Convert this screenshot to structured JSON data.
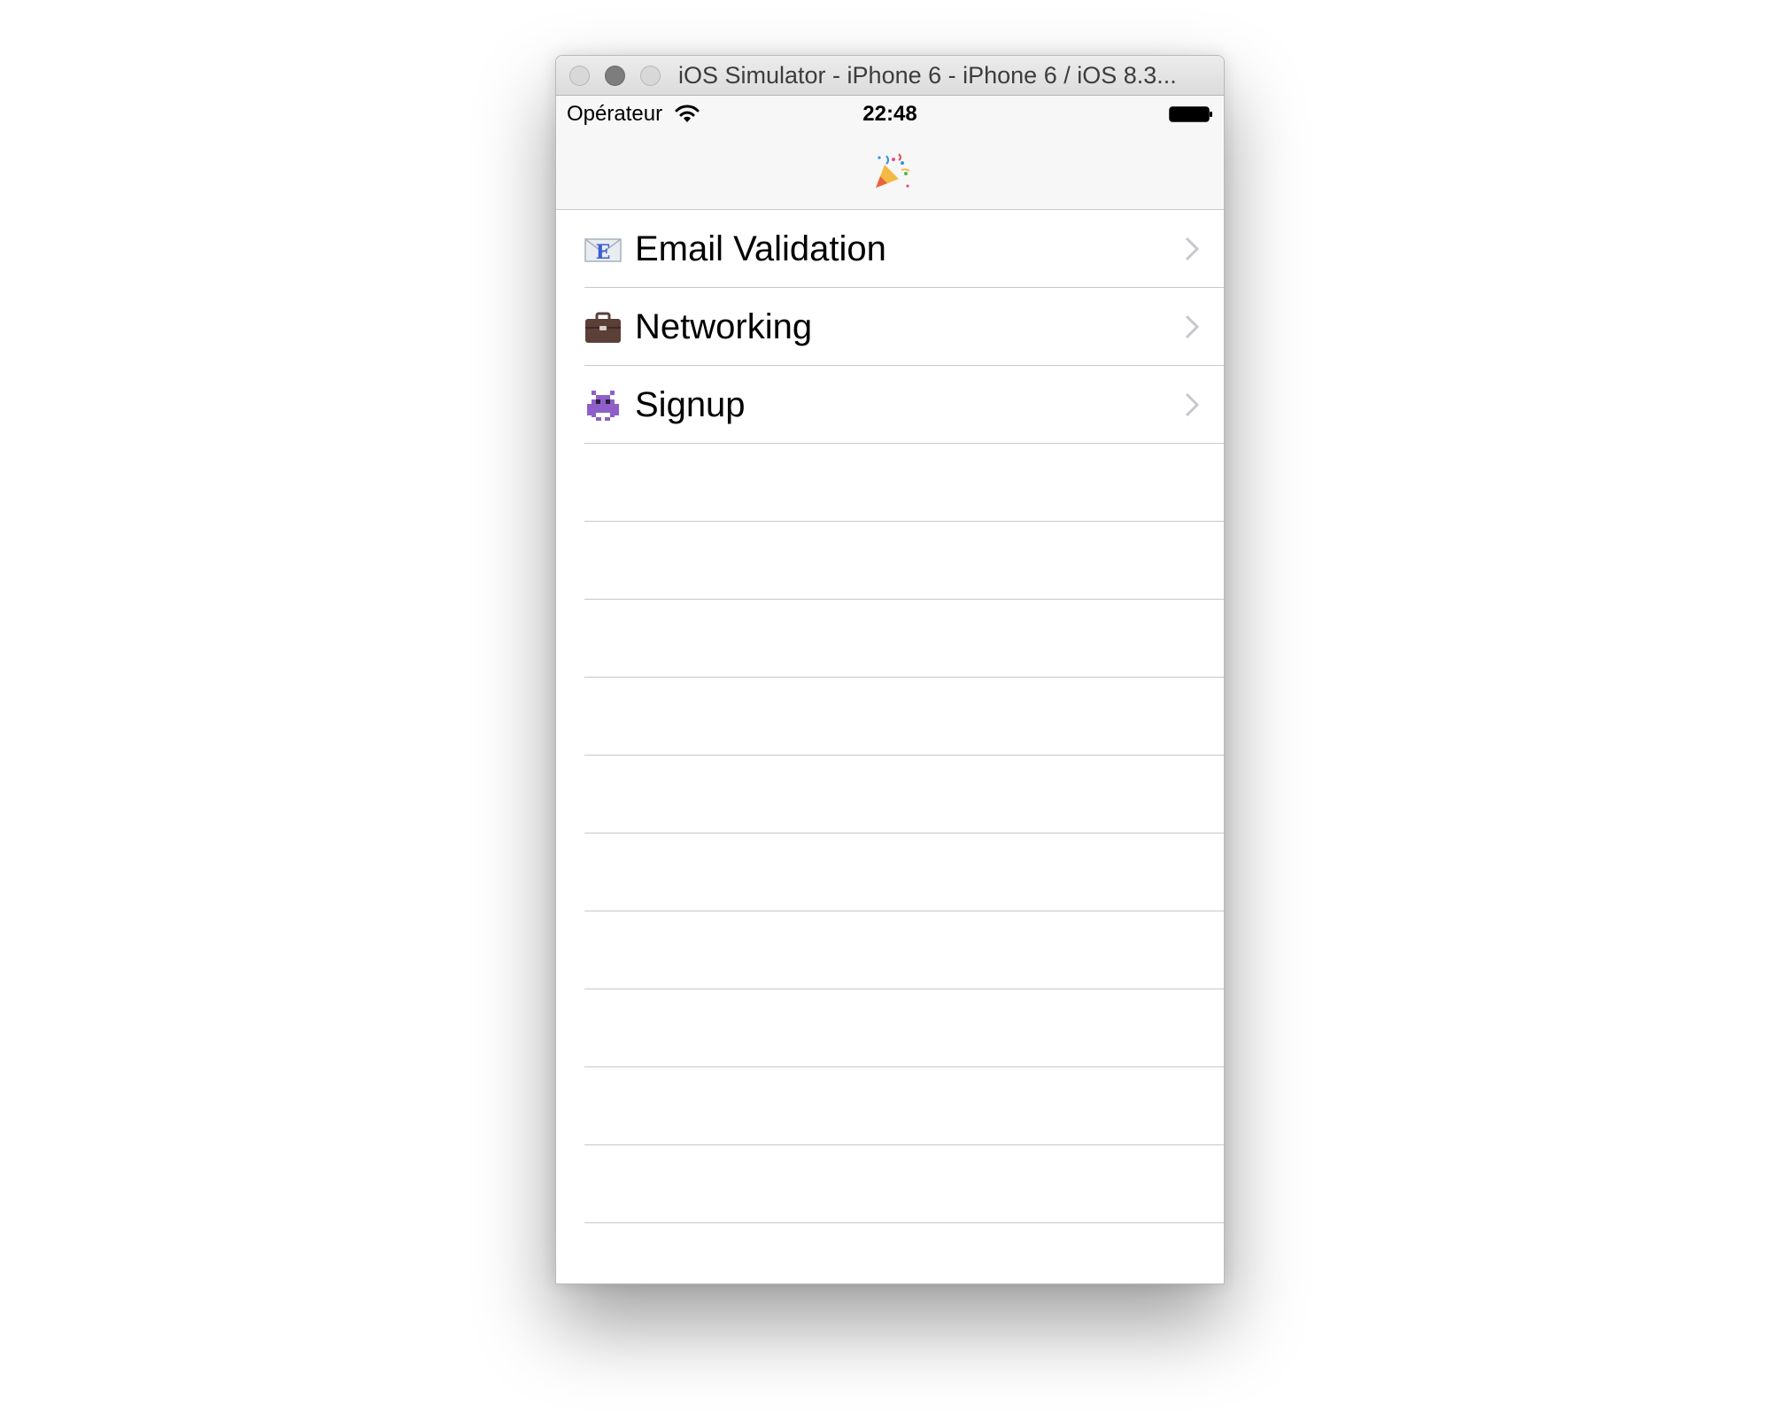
{
  "window": {
    "title": "iOS Simulator - iPhone 6 - iPhone 6 / iOS 8.3..."
  },
  "status_bar": {
    "carrier": "Opérateur",
    "time": "22:48",
    "wifi_icon": "wifi-icon",
    "battery_icon": "battery-full-icon"
  },
  "nav_bar": {
    "title_icon": "party-popper-icon"
  },
  "table": {
    "rows": [
      {
        "label": "Email Validation",
        "icon": "e-mail-envelope-icon"
      },
      {
        "label": "Networking",
        "icon": "briefcase-icon"
      },
      {
        "label": "Signup",
        "icon": "alien-monster-icon"
      }
    ],
    "empty_row_count": 10
  },
  "colors": {
    "bar_background": "#f7f7f7",
    "separator": "#c8c7cc",
    "chevron": "#c7c7cc"
  }
}
